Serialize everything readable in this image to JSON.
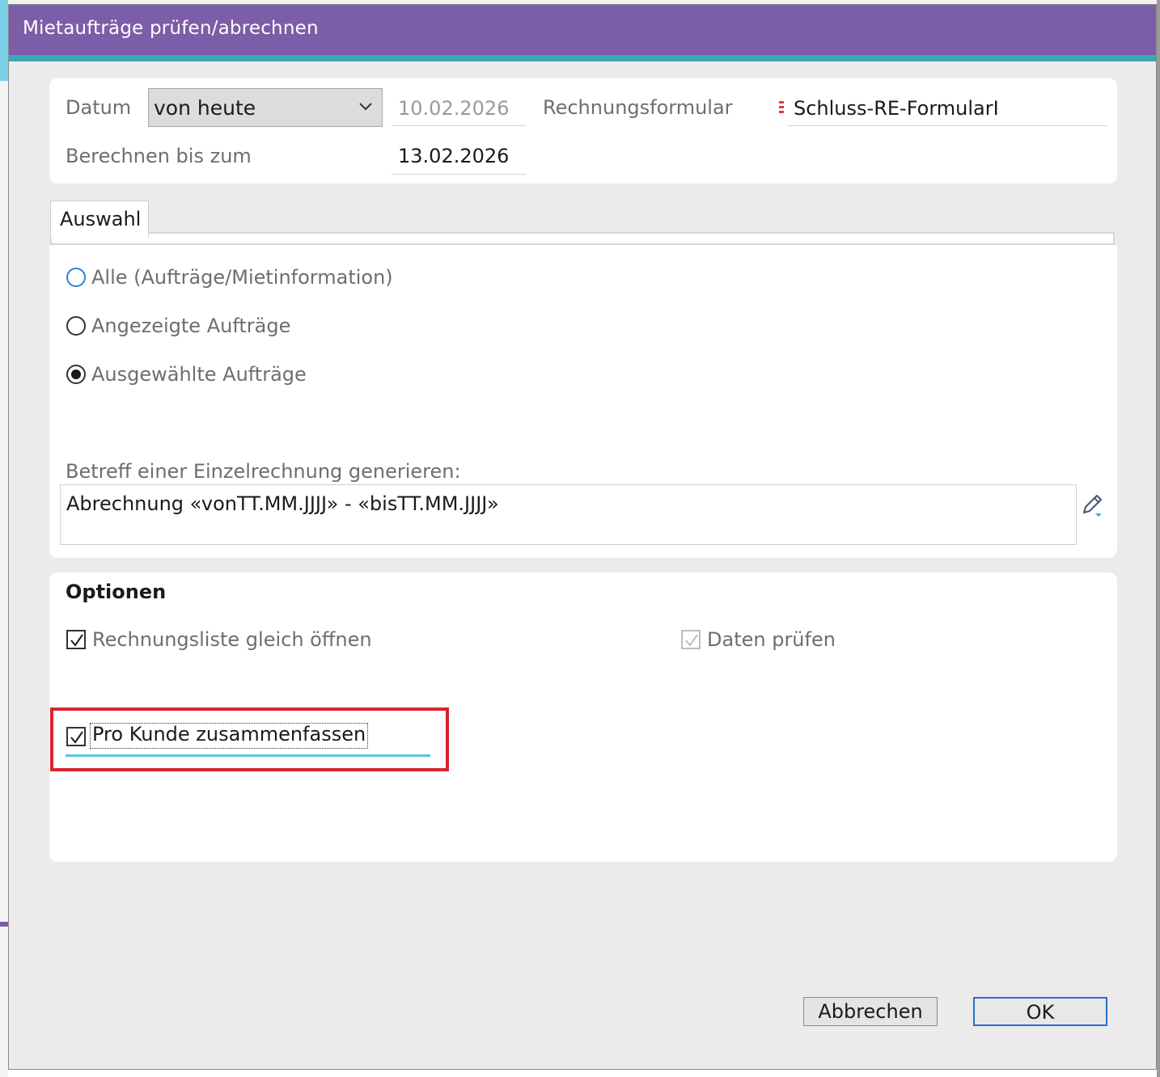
{
  "dialog": {
    "title": "Mietaufträge prüfen/abrechnen"
  },
  "header": {
    "datum_label": "Datum",
    "datum_combo_value": "von heute",
    "datum_date": "10.02.2026",
    "rechnungsformular_label": "Rechnungsformular",
    "rechnungsformular_value": "Schluss-RE-FormularI",
    "berechnen_label": "Berechnen bis zum",
    "berechnen_date": "13.02.2026"
  },
  "tabs": [
    {
      "label": "Auswahl",
      "active": true
    }
  ],
  "auswahl": {
    "options": [
      {
        "label": "Alle (Aufträge/Mietinformation)",
        "checked": false,
        "focused": true
      },
      {
        "label": "Angezeigte Aufträge",
        "checked": false,
        "focused": false
      },
      {
        "label": "Ausgewählte Aufträge",
        "checked": true,
        "focused": false
      }
    ],
    "betreff_label": "Betreff einer Einzelrechnung generieren:",
    "betreff_value": "Abrechnung «vonTT.MM.JJJJ» - «bisTT.MM.JJJJ»"
  },
  "optionen": {
    "title": "Optionen",
    "rechnungsliste_label": "Rechnungsliste gleich öffnen",
    "rechnungsliste_checked": true,
    "daten_pruefen_label": "Daten prüfen",
    "daten_pruefen_checked": true,
    "daten_pruefen_disabled": true,
    "pro_kunde_label": "Pro Kunde zusammenfassen",
    "pro_kunde_checked": true
  },
  "buttons": {
    "cancel": "Abbrechen",
    "ok": "OK"
  },
  "colors": {
    "titlebar": "#7b5ea7",
    "accent": "#3ba7b8",
    "highlight": "#d9232d",
    "focus_blue": "#2f7fd6"
  }
}
